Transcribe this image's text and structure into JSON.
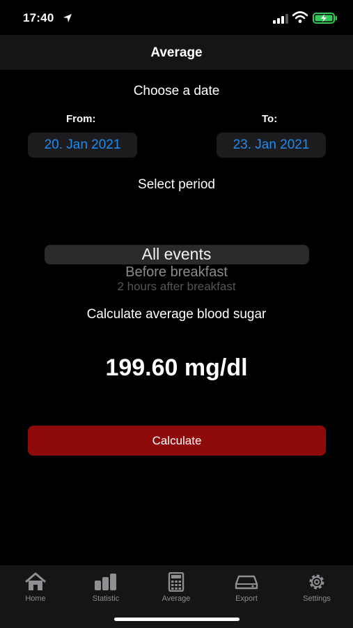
{
  "status": {
    "time": "17:40"
  },
  "nav": {
    "title": "Average"
  },
  "date_section": {
    "title": "Choose a date",
    "from_label": "From:",
    "to_label": "To:",
    "from_value": "20. Jan 2021",
    "to_value": "23. Jan 2021"
  },
  "period_section": {
    "title": "Select period",
    "options": [
      "All events",
      "Before breakfast",
      "2 hours after breakfast"
    ],
    "selected": "All events"
  },
  "result": {
    "label": "Calculate average blood sugar",
    "value": "199.60 mg/dl"
  },
  "calculate_button": {
    "label": "Calculate",
    "color": "#8f0a0a"
  },
  "tabs": [
    {
      "label": "Home",
      "icon": "home-icon"
    },
    {
      "label": "Statistic",
      "icon": "bar-chart-icon"
    },
    {
      "label": "Average",
      "icon": "calculator-icon"
    },
    {
      "label": "Export",
      "icon": "drive-icon"
    },
    {
      "label": "Settings",
      "icon": "gear-icon"
    }
  ],
  "colors": {
    "accent": "#1e8bf0",
    "tab_inactive": "#8e8e93",
    "battery": "#34c759"
  }
}
